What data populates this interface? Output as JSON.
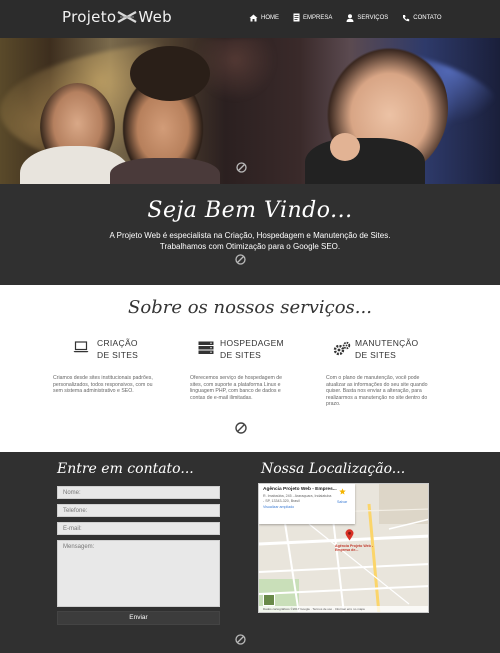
{
  "header": {
    "logo_left": "Projeto",
    "logo_right": "Web",
    "nav": [
      {
        "label": "Home",
        "icon": "home-icon"
      },
      {
        "label": "Empresa",
        "icon": "document-icon"
      },
      {
        "label": "Serviços",
        "icon": "user-icon"
      },
      {
        "label": "Contato",
        "icon": "phone-icon"
      }
    ]
  },
  "welcome": {
    "title": "Seja Bem Vindo...",
    "line1": "A Projeto Web é especialista na Criação, Hospedagem e Manutenção de Sites.",
    "line2": "Trabalhamos com Otimização para o Google SEO."
  },
  "services": {
    "title": "Sobre os nossos serviços...",
    "items": [
      {
        "title_line1": "Criação",
        "title_line2": "de Sites",
        "icon": "laptop-icon",
        "desc": "Criamos desde sites institucionais padrões, personalizados, todos responsivos, com ou sem sistema administrativo e SEO."
      },
      {
        "title_line1": "Hospedagem",
        "title_line2": "de Sites",
        "icon": "server-icon",
        "desc": "Oferecemos serviço de hospedagem de sites, com suporte a plataforma Linux e linguagem PHP, com banco de dados e contas de e-mail ilimitadas."
      },
      {
        "title_line1": "Manutenção",
        "title_line2": "de Sites",
        "icon": "gears-icon",
        "desc": "Com o plano de manutenção, você pode atualizar as informações do seu site quando quiser. Basta nos enviar a alteração, para realizarmos a manutenção no site dentro do prazo."
      }
    ]
  },
  "contact": {
    "title": "Entre em contato...",
    "fields": {
      "name_placeholder": "Nome:",
      "phone_placeholder": "Telefone:",
      "email_placeholder": "E-mail:",
      "message_placeholder": "Mensagem:"
    },
    "send_label": "Enviar"
  },
  "location": {
    "title": "Nossa Localização...",
    "card_title": "Agência Projeto Web - Empres...",
    "card_address": "R. Imabaúba, 245 - Araraquara, Indaiatuba - SP, 13343-320, Brasil",
    "card_link": "Visualizar ampliado",
    "save_label": "Salvar",
    "pin_label": "Agência Projeto Web - Empresa de...",
    "footer": "Dados cartográficos ©2017 Google · Termos de uso · Informar erro no mapa"
  },
  "colors": {
    "dark_bg": "#303030",
    "header_bg": "#2c2c2c",
    "services_bg": "#ffffff",
    "field_bg": "#e8e8e8"
  }
}
